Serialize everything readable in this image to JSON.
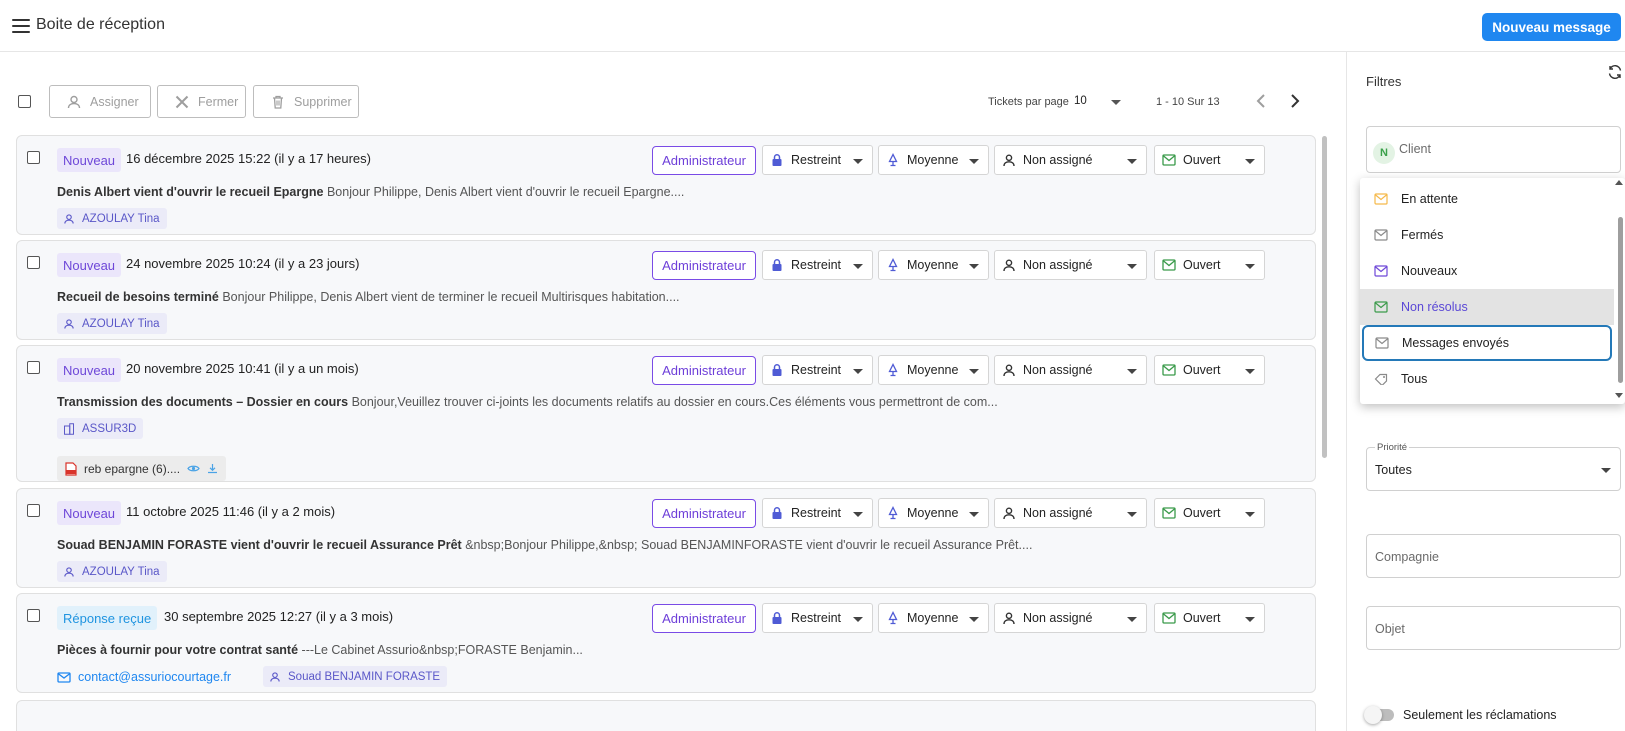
{
  "header": {
    "title": "Boite de réception",
    "new_message": "Nouveau message"
  },
  "toolbar": {
    "assign": "Assigner",
    "close": "Fermer",
    "delete": "Supprimer",
    "per_page_label": "Tickets par page",
    "per_page_value": "10",
    "range": "1 - 10 Sur 13"
  },
  "tickets": [
    {
      "status": "Nouveau",
      "date": "16 décembre 2025 15:22 (il y a 17 heures)",
      "subject": "Denis Albert vient d'ouvrir le recueil Epargne",
      "preview": "Bonjour Philippe, Denis Albert vient d'ouvrir le recueil Epargne....",
      "role": "Administrateur",
      "visibility": "Restreint",
      "priority": "Moyenne",
      "assignee": "Non assigné",
      "state": "Ouvert",
      "tags": [
        "AZOULAY Tina"
      ]
    },
    {
      "status": "Nouveau",
      "date": "24 novembre 2025 10:24 (il y a 23 jours)",
      "subject": "Recueil de besoins terminé",
      "preview": "Bonjour Philippe, Denis Albert vient de terminer le recueil Multirisques habitation....",
      "role": "Administrateur",
      "visibility": "Restreint",
      "priority": "Moyenne",
      "assignee": "Non assigné",
      "state": "Ouvert",
      "tags": [
        "AZOULAY Tina"
      ]
    },
    {
      "status": "Nouveau",
      "date": "20 novembre 2025 10:41 (il y a un mois)",
      "subject": "Transmission des documents – Dossier en cours",
      "preview": "Bonjour,Veuillez trouver ci-joints les documents relatifs au dossier en cours.Ces éléments vous permettront de com...",
      "role": "Administrateur",
      "visibility": "Restreint",
      "priority": "Moyenne",
      "assignee": "Non assigné",
      "state": "Ouvert",
      "company_tag": "ASSUR3D",
      "attachment": "reb epargne (6)...."
    },
    {
      "status": "Nouveau",
      "date": "11 octobre 2025 11:46 (il y a 2 mois)",
      "subject": "Souad BENJAMIN FORASTE vient d'ouvrir le recueil Assurance Prêt",
      "preview": "&nbsp;Bonjour Philippe,&nbsp; Souad BENJAMINFORASTE vient d'ouvrir le recueil Assurance Prêt....",
      "role": "Administrateur",
      "visibility": "Restreint",
      "priority": "Moyenne",
      "assignee": "Non assigné",
      "state": "Ouvert",
      "tags": [
        "AZOULAY Tina"
      ]
    },
    {
      "status": "Réponse reçue",
      "date": "30 septembre 2025 12:27 (il y a 3 mois)",
      "subject": "Pièces à fournir pour votre contrat santé",
      "preview": "---Le Cabinet Assurio&nbsp;FORASTE Benjamin...",
      "role": "Administrateur",
      "visibility": "Restreint",
      "priority": "Moyenne",
      "assignee": "Non assigné",
      "state": "Ouvert",
      "email": "contact@assuriocourtage.fr",
      "tags": [
        "Souad BENJAMIN FORASTE"
      ]
    }
  ],
  "filters": {
    "title": "Filtres",
    "client_placeholder": "Client",
    "client_avatar": "N",
    "priority_label": "Priorité",
    "priority_value": "Toutes",
    "company_placeholder": "Compagnie",
    "object_placeholder": "Objet",
    "claims_only": "Seulement les réclamations"
  },
  "dropdown": {
    "items": [
      {
        "label": "En attente",
        "icon": "mail-icon",
        "color": "#f5b94a"
      },
      {
        "label": "Fermés",
        "icon": "mail-icon",
        "color": "#8a8a8a"
      },
      {
        "label": "Nouveaux",
        "icon": "mail-icon",
        "color": "#6e47d8"
      },
      {
        "label": "Non résolus",
        "icon": "mail-icon",
        "color": "#3a9a4a"
      },
      {
        "label": "Messages envoyés",
        "icon": "mail-icon",
        "color": "#8a8a8a"
      },
      {
        "label": "Tous",
        "icon": "tag-icon",
        "color": "#8a8a8a"
      }
    ],
    "selected": "Non résolus",
    "focused": "Messages envoyés"
  },
  "colors": {
    "primary": "#1f87f0",
    "accent_purple": "#6e3fd9",
    "focus_ring": "#2479b8"
  }
}
